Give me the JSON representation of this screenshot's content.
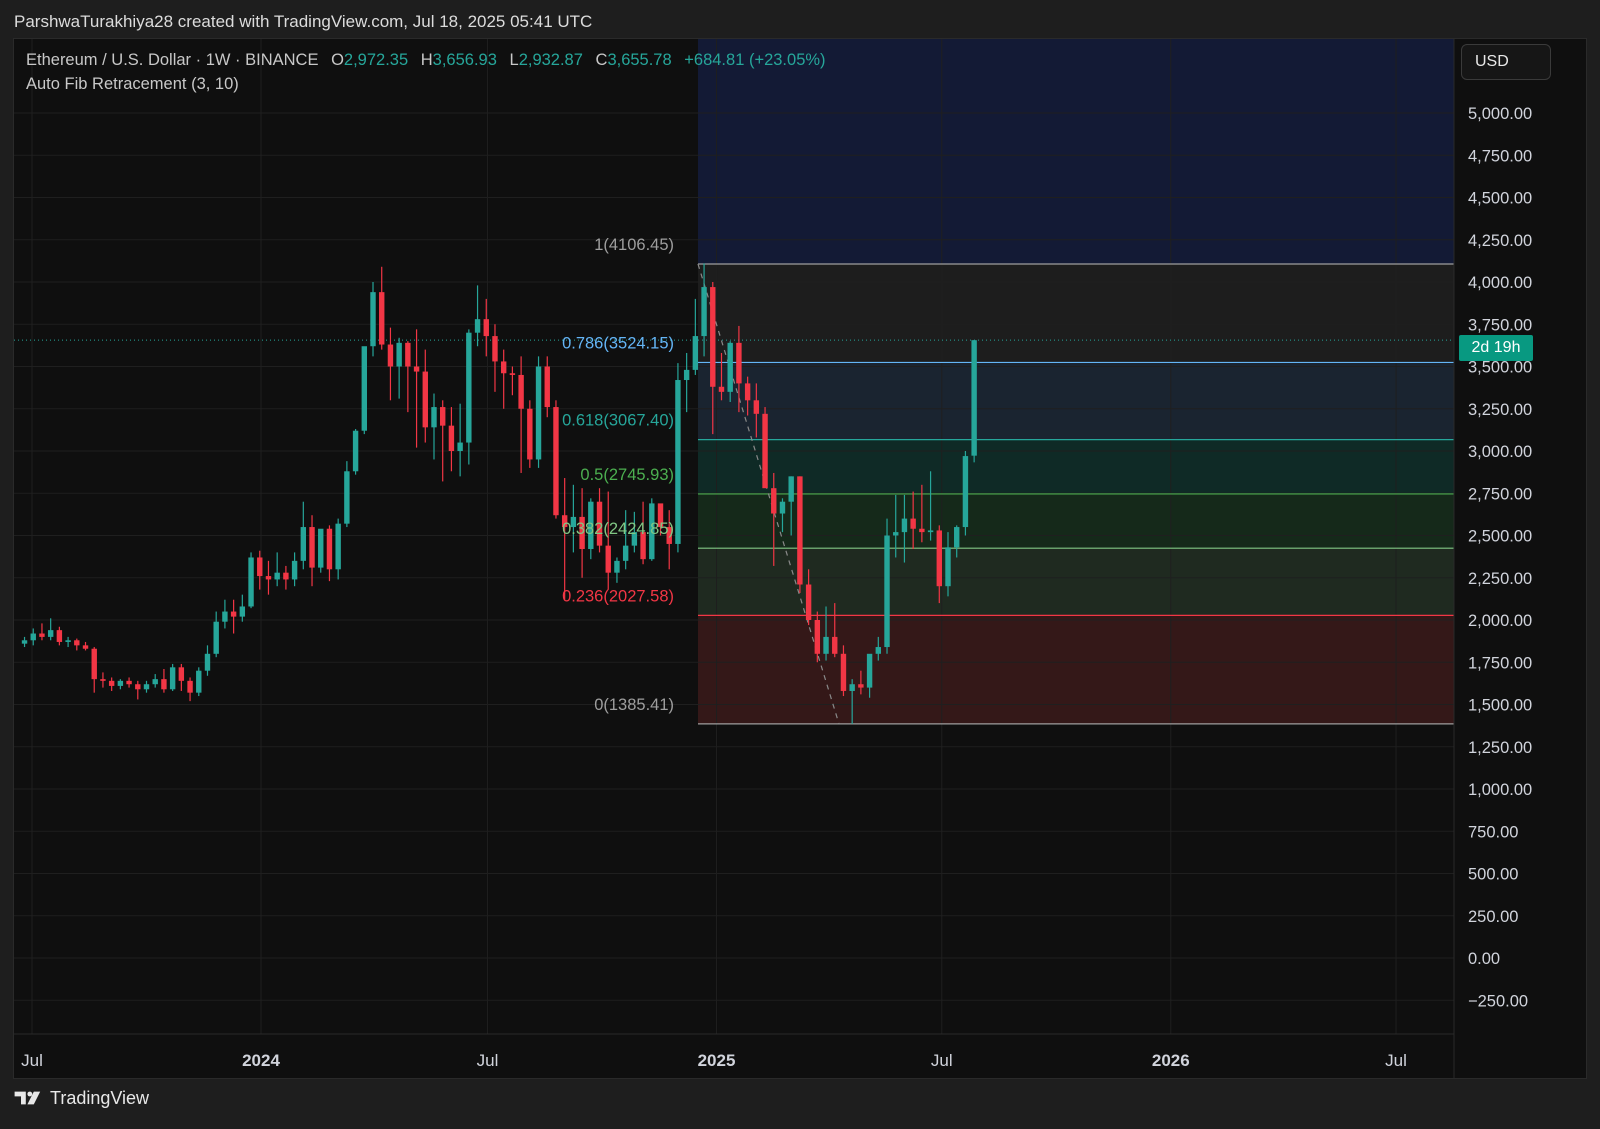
{
  "header": {
    "attribution": "ParshwaTurakhiya28 created with TradingView.com, Jul 18, 2025 05:41 UTC"
  },
  "legend": {
    "symbol": "Ethereum / U.S. Dollar · 1W · BINANCE",
    "open_label": "O",
    "open": "2,972.35",
    "high_label": "H",
    "high": "3,656.93",
    "low_label": "L",
    "low": "2,932.87",
    "close_label": "C",
    "close": "3,655.78",
    "change": "+684.81 (+23.05%)",
    "indicator": "Auto Fib Retracement (3, 10)"
  },
  "currency_button": "USD",
  "countdown": "2d 19h",
  "footer": {
    "brand": "TradingView"
  },
  "colors": {
    "up": "#26a69a",
    "down": "#f23645",
    "background": "#0f0f0f",
    "grid": "#1f1f1f"
  },
  "chart_data": {
    "type": "candlestick",
    "interval": "1W",
    "ylim": [
      -250,
      5000
    ],
    "y_ticks": [
      "5,000.00",
      "4,750.00",
      "4,500.00",
      "4,250.00",
      "4,000.00",
      "3,750.00",
      "3,500.00",
      "3,250.00",
      "3,000.00",
      "2,750.00",
      "2,500.00",
      "2,250.00",
      "2,000.00",
      "1,750.00",
      "1,500.00",
      "1,250.00",
      "1,000.00",
      "750.00",
      "500.00",
      "250.00",
      "0.00",
      "−250.00"
    ],
    "x_ticks": [
      {
        "label": "Jul",
        "date": "2023-07-01",
        "bold": false
      },
      {
        "label": "2024",
        "date": "2024-01-01",
        "bold": true
      },
      {
        "label": "Jul",
        "date": "2024-07-01",
        "bold": false
      },
      {
        "label": "2025",
        "date": "2025-01-01",
        "bold": true
      },
      {
        "label": "Jul",
        "date": "2025-07-01",
        "bold": false
      },
      {
        "label": "2026",
        "date": "2026-01-01",
        "bold": true
      },
      {
        "label": "Jul",
        "date": "2026-07-01",
        "bold": false
      }
    ],
    "fib_levels": [
      {
        "ratio": 1,
        "price": 4106.45,
        "label": "1(4106.45)",
        "color": "#9e9e9e",
        "fill": "#1d1d1d"
      },
      {
        "ratio": 0.786,
        "price": 3524.15,
        "label": "0.786(3524.15)",
        "color": "#64b5f6",
        "fill": "#1a2430"
      },
      {
        "ratio": 0.618,
        "price": 3067.4,
        "label": "0.618(3067.40)",
        "color": "#26a69a",
        "fill": "#0f2a26"
      },
      {
        "ratio": 0.5,
        "price": 2745.93,
        "label": "0.5(2745.93)",
        "color": "#4caf50",
        "fill": "#15291a"
      },
      {
        "ratio": 0.382,
        "price": 2424.85,
        "label": "0.382(2424.85)",
        "color": "#81c784",
        "fill": "#1f2a20"
      },
      {
        "ratio": 0.236,
        "price": 2027.58,
        "label": "0.236(2027.58)",
        "color": "#f23645",
        "fill": "#341818"
      },
      {
        "ratio": 0,
        "price": 1385.41,
        "label": "0(1385.41)",
        "color": "#9e9e9e",
        "fill": null
      }
    ],
    "upper_zone_fill": "#131a35",
    "current_price": 3655.78,
    "candles_start": "2023-06-25",
    "candles": [
      [
        1860,
        1900,
        1840,
        1880
      ],
      [
        1880,
        1950,
        1850,
        1920
      ],
      [
        1920,
        1980,
        1880,
        1900
      ],
      [
        1900,
        2010,
        1880,
        1940
      ],
      [
        1940,
        1960,
        1850,
        1870
      ],
      [
        1870,
        1900,
        1840,
        1880
      ],
      [
        1880,
        1890,
        1820,
        1850
      ],
      [
        1850,
        1870,
        1820,
        1830
      ],
      [
        1830,
        1840,
        1570,
        1650
      ],
      [
        1650,
        1690,
        1600,
        1640
      ],
      [
        1640,
        1660,
        1580,
        1610
      ],
      [
        1610,
        1650,
        1590,
        1640
      ],
      [
        1640,
        1660,
        1600,
        1620
      ],
      [
        1620,
        1640,
        1530,
        1590
      ],
      [
        1590,
        1640,
        1570,
        1620
      ],
      [
        1620,
        1680,
        1600,
        1650
      ],
      [
        1650,
        1710,
        1570,
        1590
      ],
      [
        1590,
        1740,
        1580,
        1720
      ],
      [
        1720,
        1740,
        1580,
        1640
      ],
      [
        1640,
        1660,
        1520,
        1570
      ],
      [
        1570,
        1720,
        1550,
        1700
      ],
      [
        1700,
        1850,
        1670,
        1800
      ],
      [
        1800,
        2050,
        1780,
        1990
      ],
      [
        1990,
        2120,
        1950,
        2050
      ],
      [
        2050,
        2120,
        1920,
        2020
      ],
      [
        2020,
        2150,
        1990,
        2080
      ],
      [
        2080,
        2400,
        2070,
        2370
      ],
      [
        2370,
        2410,
        2180,
        2260
      ],
      [
        2260,
        2350,
        2150,
        2240
      ],
      [
        2240,
        2400,
        2200,
        2280
      ],
      [
        2280,
        2320,
        2180,
        2240
      ],
      [
        2240,
        2400,
        2200,
        2350
      ],
      [
        2350,
        2700,
        2300,
        2550
      ],
      [
        2550,
        2620,
        2200,
        2310
      ],
      [
        2310,
        2500,
        2280,
        2540
      ],
      [
        2540,
        2560,
        2230,
        2300
      ],
      [
        2300,
        2600,
        2240,
        2570
      ],
      [
        2570,
        2940,
        2550,
        2880
      ],
      [
        2880,
        3130,
        2860,
        3120
      ],
      [
        3120,
        3530,
        3100,
        3620
      ],
      [
        3620,
        4000,
        3560,
        3940
      ],
      [
        3940,
        4090,
        3600,
        3630
      ],
      [
        3630,
        3730,
        3300,
        3500
      ],
      [
        3500,
        3670,
        3310,
        3640
      ],
      [
        3640,
        3650,
        3230,
        3500
      ],
      [
        3500,
        3720,
        3020,
        3470
      ],
      [
        3470,
        3600,
        3050,
        3140
      ],
      [
        3140,
        3340,
        2950,
        3260
      ],
      [
        3260,
        3300,
        2820,
        3150
      ],
      [
        3150,
        3260,
        2880,
        3000
      ],
      [
        3000,
        3280,
        2850,
        3050
      ],
      [
        3050,
        3720,
        2920,
        3700
      ],
      [
        3700,
        3980,
        3620,
        3780
      ],
      [
        3780,
        3900,
        3560,
        3680
      ],
      [
        3680,
        3750,
        3350,
        3530
      ],
      [
        3530,
        3600,
        3250,
        3460
      ],
      [
        3460,
        3500,
        3330,
        3450
      ],
      [
        3450,
        3560,
        2870,
        3250
      ],
      [
        3250,
        3300,
        2900,
        2950
      ],
      [
        2950,
        3560,
        2900,
        3500
      ],
      [
        3500,
        3560,
        3200,
        3260
      ],
      [
        3260,
        3300,
        2600,
        2620
      ],
      [
        2620,
        2840,
        2120,
        2550
      ],
      [
        2550,
        2800,
        2400,
        2610
      ],
      [
        2610,
        2780,
        2250,
        2420
      ],
      [
        2420,
        2720,
        2360,
        2700
      ],
      [
        2700,
        2780,
        2400,
        2440
      ],
      [
        2440,
        2760,
        2180,
        2280
      ],
      [
        2280,
        2370,
        2220,
        2350
      ],
      [
        2350,
        2650,
        2300,
        2440
      ],
      [
        2440,
        2640,
        2400,
        2520
      ],
      [
        2520,
        2700,
        2330,
        2360
      ],
      [
        2360,
        2720,
        2350,
        2690
      ],
      [
        2690,
        2600,
        2500,
        2550
      ],
      [
        2550,
        2650,
        2300,
        2450
      ],
      [
        2450,
        3520,
        2400,
        3420
      ],
      [
        3420,
        3580,
        3230,
        3480
      ],
      [
        3480,
        3900,
        3450,
        3680
      ],
      [
        3680,
        4110,
        3560,
        3970
      ],
      [
        3970,
        4000,
        3100,
        3380
      ],
      [
        3380,
        3580,
        3300,
        3350
      ],
      [
        3350,
        3650,
        3290,
        3640
      ],
      [
        3640,
        3740,
        3230,
        3400
      ],
      [
        3400,
        3440,
        3210,
        3300
      ],
      [
        3300,
        3400,
        3080,
        3220
      ],
      [
        3220,
        3260,
        2800,
        2780
      ],
      [
        2780,
        2870,
        2320,
        2630
      ],
      [
        2630,
        2720,
        2520,
        2700
      ],
      [
        2700,
        2850,
        2500,
        2850
      ],
      [
        2850,
        2850,
        2160,
        2210
      ],
      [
        2210,
        2300,
        1970,
        2000
      ],
      [
        2000,
        2050,
        1750,
        1800
      ],
      [
        1800,
        2080,
        1760,
        1900
      ],
      [
        1900,
        2100,
        1780,
        1800
      ],
      [
        1800,
        1850,
        1550,
        1580
      ],
      [
        1580,
        1650,
        1385,
        1620
      ],
      [
        1620,
        1700,
        1560,
        1600
      ],
      [
        1600,
        1780,
        1540,
        1800
      ],
      [
        1800,
        1900,
        1760,
        1840
      ],
      [
        1840,
        2600,
        1800,
        2500
      ],
      [
        2500,
        2740,
        2370,
        2520
      ],
      [
        2520,
        2740,
        2340,
        2600
      ],
      [
        2600,
        2760,
        2420,
        2540
      ],
      [
        2540,
        2800,
        2460,
        2520
      ],
      [
        2520,
        2880,
        2470,
        2530
      ],
      [
        2530,
        2560,
        2100,
        2200
      ],
      [
        2200,
        2520,
        2140,
        2430
      ],
      [
        2430,
        2560,
        2370,
        2550
      ],
      [
        2550,
        3000,
        2500,
        2970
      ],
      [
        2972.35,
        3656.93,
        2932.87,
        3655.78
      ]
    ]
  }
}
